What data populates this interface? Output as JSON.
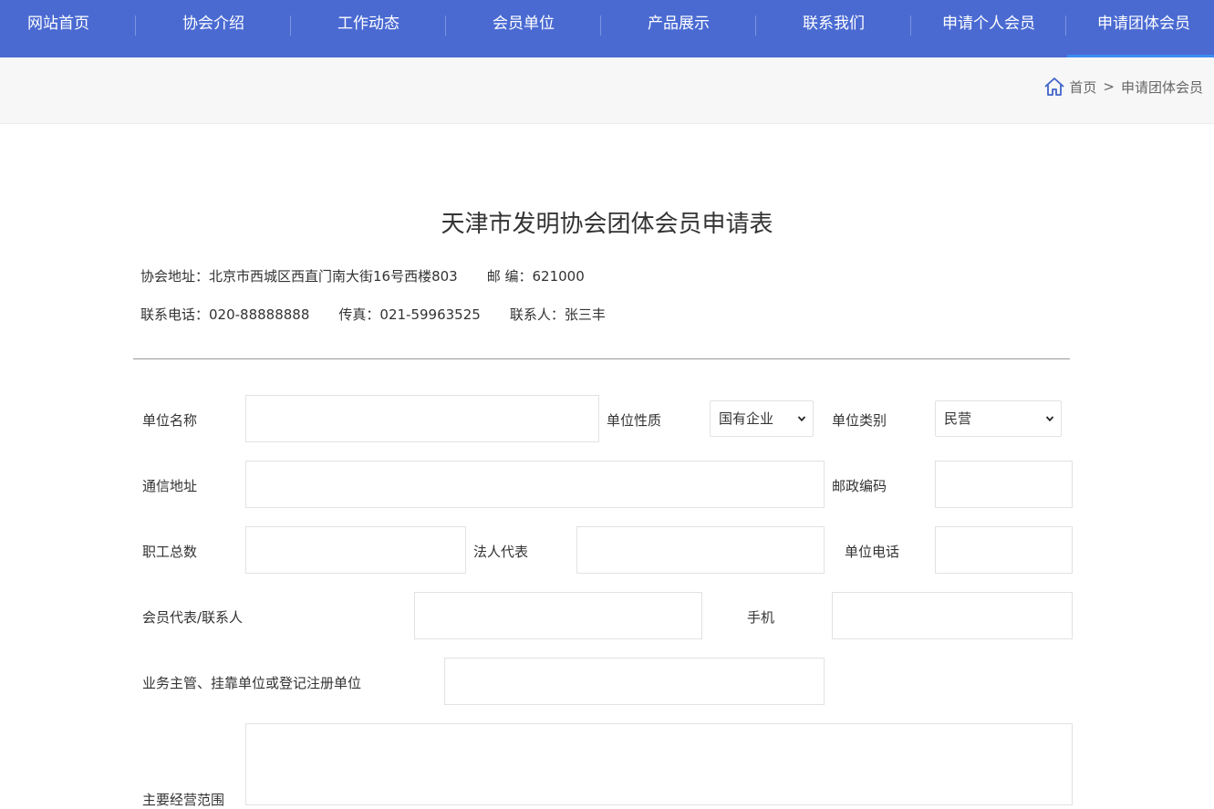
{
  "nav": {
    "items": [
      "网站首页",
      "协会介绍",
      "工作动态",
      "会员单位",
      "产品展示",
      "联系我们",
      "申请个人会员",
      "申请团体会员"
    ]
  },
  "breadcrumb": {
    "home": "首页",
    "separator": ">",
    "current": "申请团体会员"
  },
  "form_title": "天津市发明协会团体会员申请表",
  "info": {
    "address": "协会地址：北京市西城区西直门南大街16号西楼803",
    "postcode": "邮 编：621000",
    "phone": "联系电话：020-88888888",
    "fax": "传真：021-59963525",
    "contact": "联系人：张三丰"
  },
  "form": {
    "unit_name_label": "单位名称",
    "unit_nature_label": "单位性质",
    "unit_nature_value": "国有企业",
    "unit_category_label": "单位类别",
    "unit_category_value": "民营",
    "address_label": "通信地址",
    "postal_code_label": "邮政编码",
    "staff_count_label": "职工总数",
    "legal_rep_label": "法人代表",
    "unit_phone_label": "单位电话",
    "member_rep_label": "会员代表/联系人",
    "mobile_label": "手机",
    "supervisor_label": "业务主管、挂靠单位或登记注册单位",
    "main_business_label": "主要经营范围"
  },
  "colors": {
    "nav_bg": "#4a6ad2",
    "nav_active_underline": "#3a8ef0",
    "crumb_bg": "#f7f7f7"
  }
}
